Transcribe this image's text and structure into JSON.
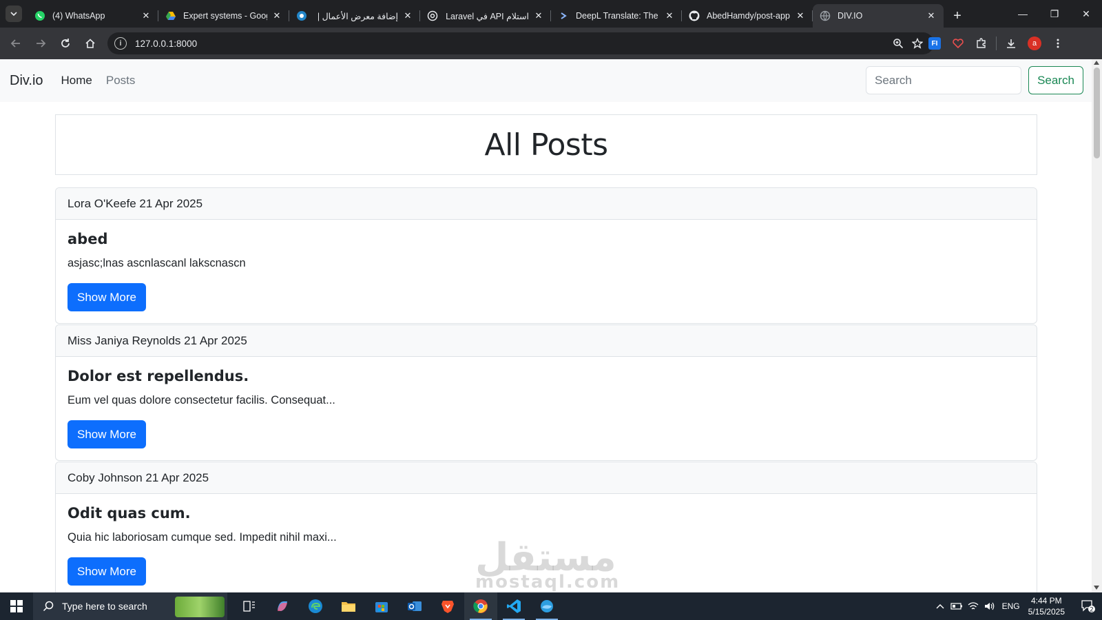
{
  "browser": {
    "tabs": [
      {
        "title": "(4) WhatsApp",
        "icon": "whatsapp-icon",
        "active": false
      },
      {
        "title": "Expert systems - Goog",
        "icon": "google-drive-icon",
        "active": false
      },
      {
        "title": "إضافة معرض الأعمال |",
        "icon": "mostaql-icon",
        "active": false
      },
      {
        "title": "استلام API في Laravel",
        "icon": "chatgpt-icon",
        "active": false
      },
      {
        "title": "DeepL Translate: The w",
        "icon": "deepl-icon",
        "active": false
      },
      {
        "title": "AbedHamdy/post-app",
        "icon": "github-icon",
        "active": false
      },
      {
        "title": "DIV.IO",
        "icon": "globe-icon",
        "active": true
      }
    ],
    "url": "127.0.0.1:8000",
    "profile_initial": "a",
    "extension_fi_label": "FI"
  },
  "navbar": {
    "brand": "Div.io",
    "links": [
      "Home",
      "Posts"
    ],
    "search_placeholder": "Search",
    "search_button": "Search"
  },
  "page": {
    "title": "All Posts",
    "posts": [
      {
        "header": "Lora O'Keefe 21 Apr 2025",
        "title": "abed",
        "body": "asjasc;lnas ascnlascanl lakscnascn",
        "button": "Show More"
      },
      {
        "header": "Miss Janiya Reynolds 21 Apr 2025",
        "title": "Dolor est repellendus.",
        "body": "Eum vel quas dolore consectetur facilis. Consequat...",
        "button": "Show More"
      },
      {
        "header": "Coby Johnson 21 Apr 2025",
        "title": "Odit quas cum.",
        "body": "Quia hic laboriosam cumque sed. Impedit nihil maxi...",
        "button": "Show More"
      }
    ]
  },
  "watermark": {
    "arabic": "مستقل",
    "latin": "mostaql.com"
  },
  "taskbar": {
    "search_placeholder": "Type here to search",
    "language": "ENG",
    "time": "4:44 PM",
    "date": "5/15/2025",
    "notification_count": "2"
  },
  "colors": {
    "primary": "#0d6efd",
    "success": "#198754",
    "navbar_bg": "#f8f9fa",
    "chrome_dark": "#202124"
  }
}
